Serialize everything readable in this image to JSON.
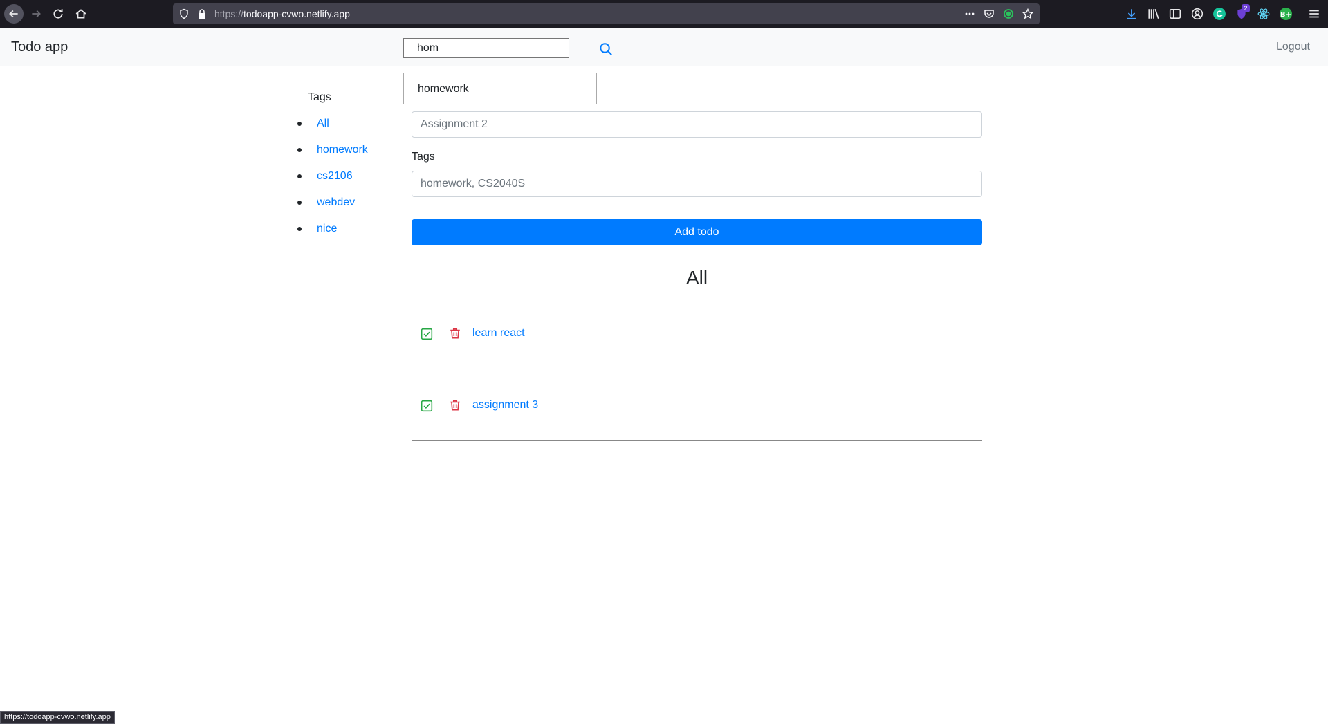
{
  "browser": {
    "url_protocol": "https://",
    "url_host": "todoapp-cvwo.netlify.app",
    "badge_count": "2",
    "status_url": "https://todoapp-cvwo.netlify.app"
  },
  "navbar": {
    "brand": "Todo app",
    "search_value": "hom",
    "logout_label": "Logout"
  },
  "search_suggestion": "homework",
  "sidebar": {
    "title": "Tags",
    "tags": [
      "All",
      "homework",
      "cs2106",
      "webdev",
      "nice"
    ]
  },
  "form": {
    "title_placeholder": "Assignment 2",
    "tags_label": "Tags",
    "tags_placeholder": "homework, CS2040S",
    "add_label": "Add todo"
  },
  "list": {
    "heading": "All",
    "todos": [
      "learn react",
      "assignment 3"
    ]
  },
  "colors": {
    "primary": "#007bff",
    "success": "#28a745",
    "danger": "#dc3545",
    "navbar_bg": "#f8f9fa"
  }
}
